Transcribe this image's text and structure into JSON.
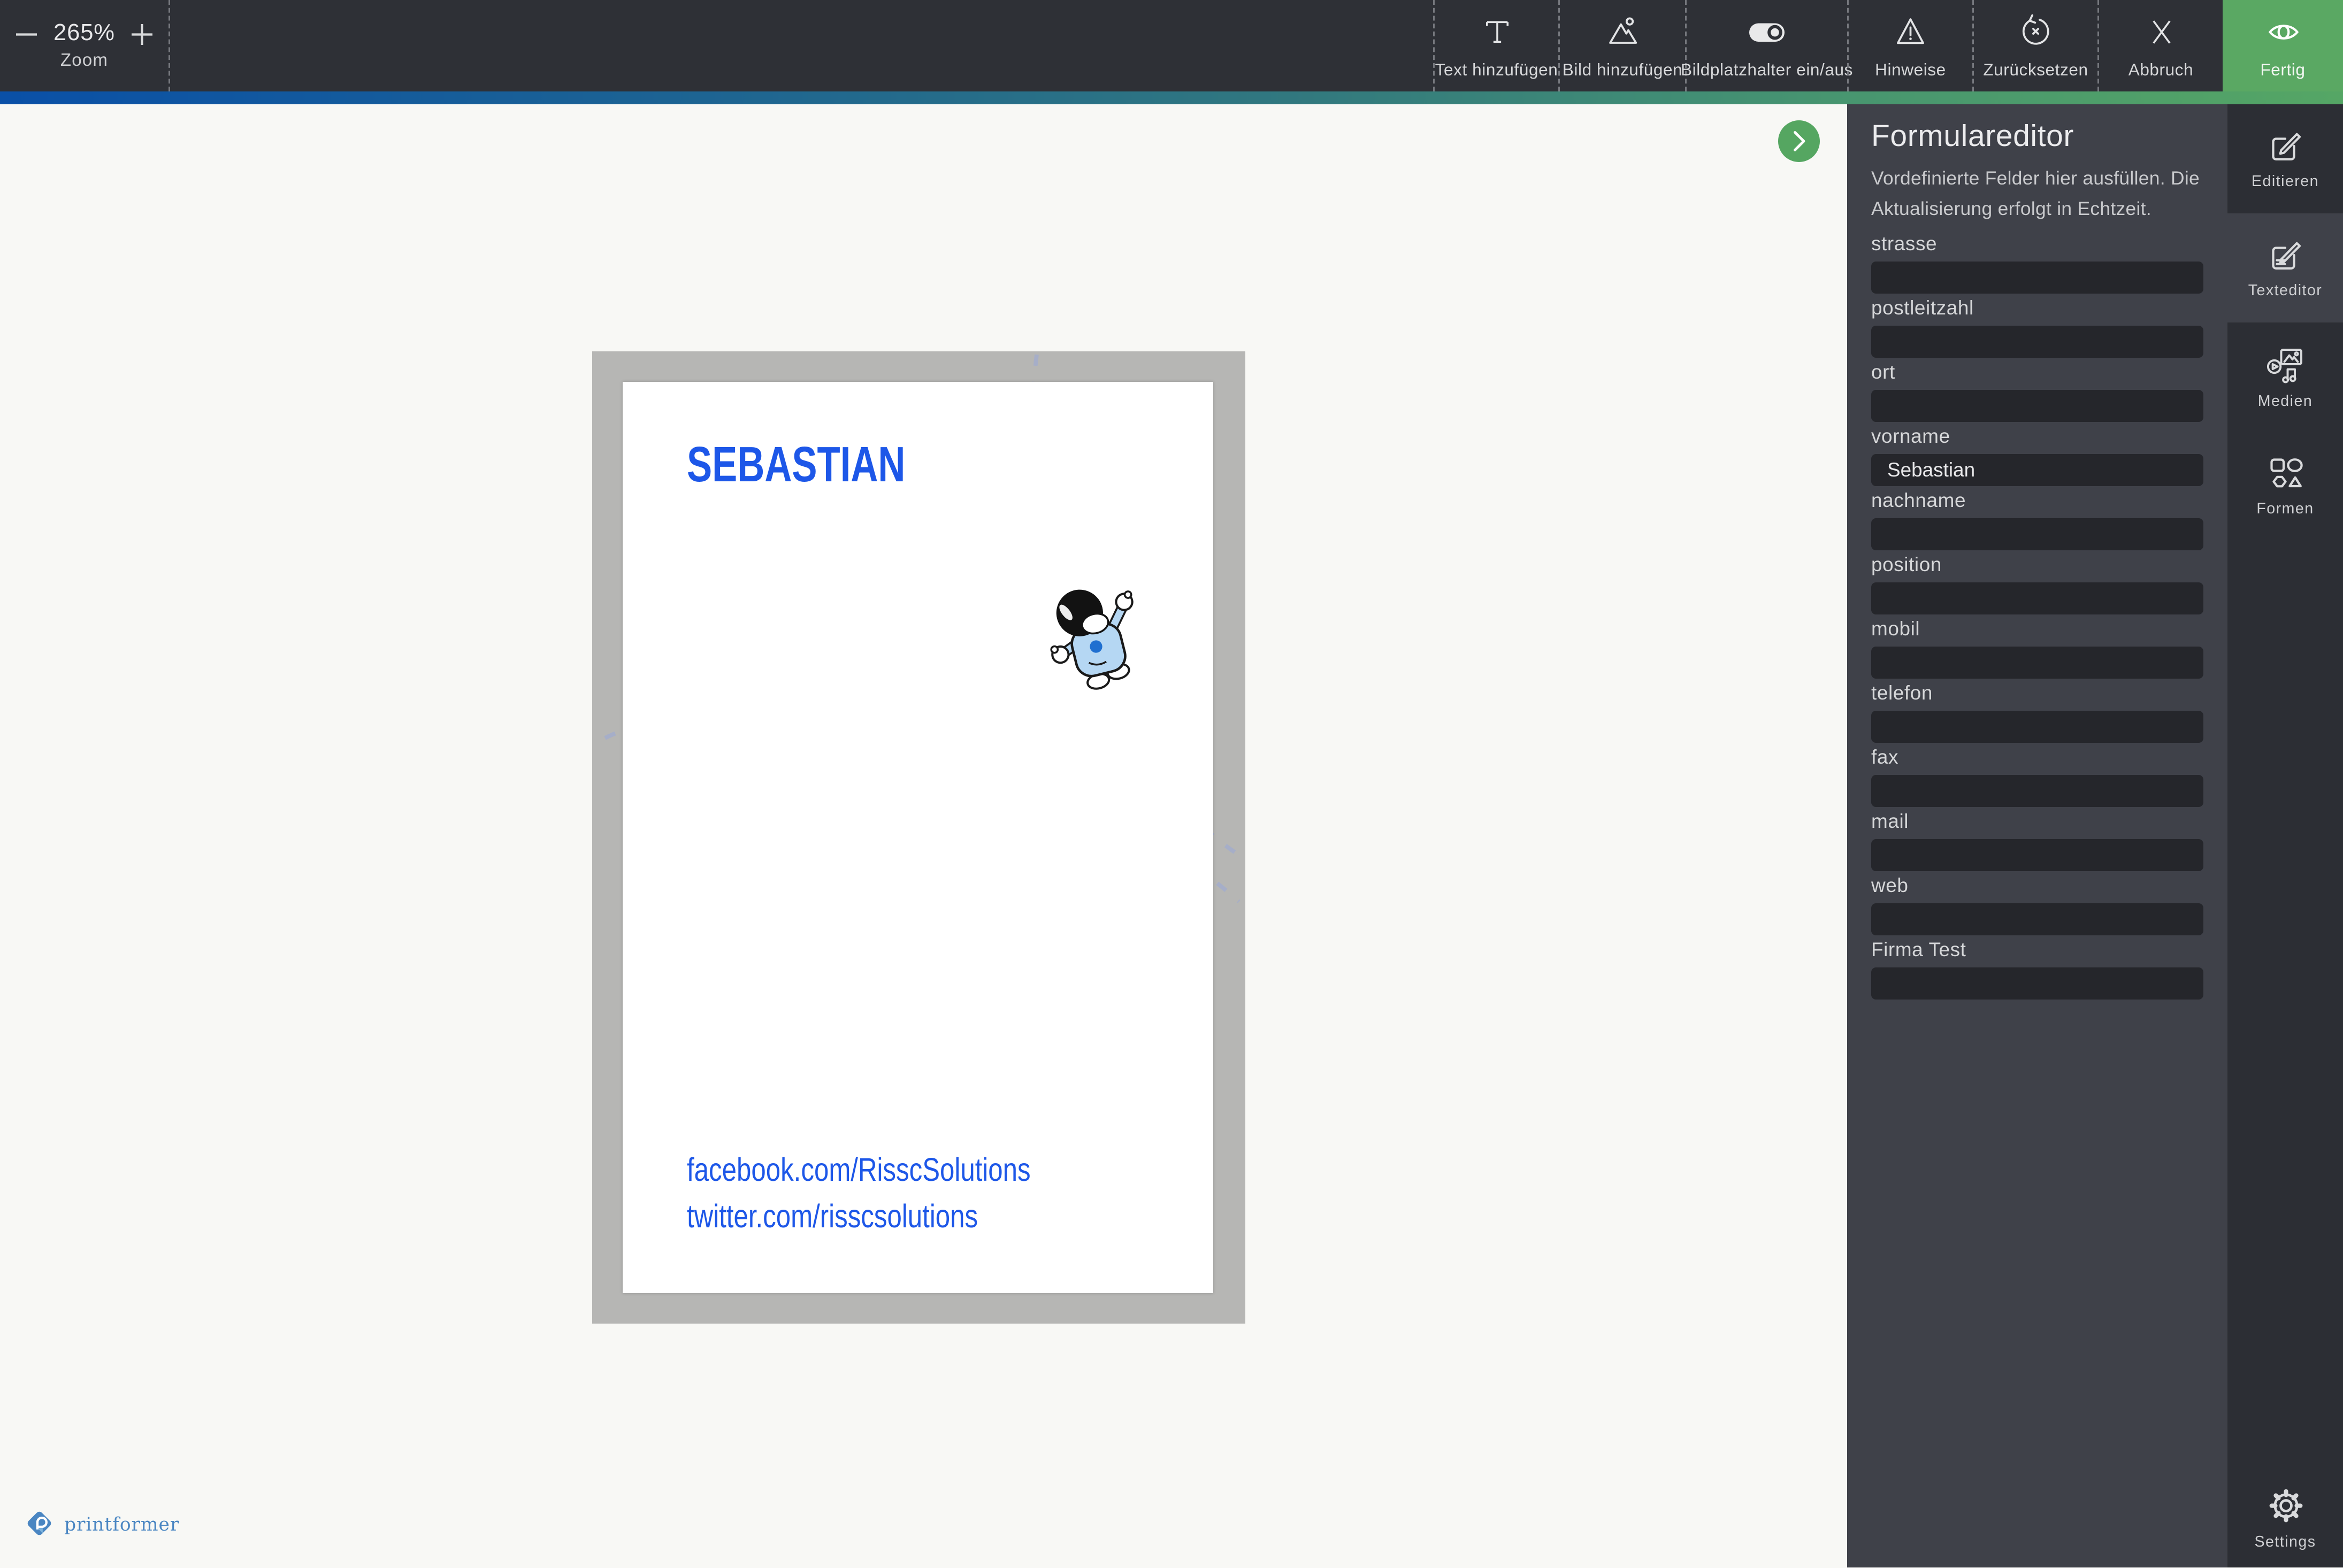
{
  "toolbar": {
    "zoom": {
      "value": "265%",
      "label": "Zoom"
    },
    "buttons": [
      {
        "label": "Text hinzufügen",
        "icon": "text-add-icon"
      },
      {
        "label": "Bild hinzufügen",
        "icon": "image-add-icon"
      },
      {
        "label": "Bildplatzhalter ein/aus",
        "icon": "toggle-on-icon"
      },
      {
        "label": "Hinweise",
        "icon": "warning-icon"
      },
      {
        "label": "Zurücksetzen",
        "icon": "reset-icon"
      },
      {
        "label": "Abbruch",
        "icon": "close-icon"
      },
      {
        "label": "Fertig",
        "icon": "eye-icon"
      }
    ]
  },
  "canvas": {
    "card": {
      "name_text": "SEBASTIAN",
      "social_lines": [
        "facebook.com/RisscSolutions",
        "twitter.com/risscsolutions"
      ],
      "illustration": "astronaut-with-dashed-trajectories"
    },
    "next_button_icon": "chevron-right-icon"
  },
  "form_panel": {
    "title": "Formulareditor",
    "subtitle": "Vordefinierte Felder hier ausfüllen. Die Aktualisierung erfolgt in Echtzeit.",
    "fields": [
      {
        "label": "strasse",
        "value": ""
      },
      {
        "label": "postleitzahl",
        "value": ""
      },
      {
        "label": "ort",
        "value": ""
      },
      {
        "label": "vorname",
        "value": "Sebastian"
      },
      {
        "label": "nachname",
        "value": ""
      },
      {
        "label": "position",
        "value": ""
      },
      {
        "label": "mobil",
        "value": ""
      },
      {
        "label": "telefon",
        "value": ""
      },
      {
        "label": "fax",
        "value": ""
      },
      {
        "label": "mail",
        "value": ""
      },
      {
        "label": "web",
        "value": ""
      },
      {
        "label": "Firma Test",
        "value": ""
      }
    ]
  },
  "sidebar": {
    "items": [
      {
        "label": "Editieren",
        "icon": "edit-icon",
        "active": false
      },
      {
        "label": "Texteditor",
        "icon": "text-editor-icon",
        "active": true
      },
      {
        "label": "Medien",
        "icon": "media-icon",
        "active": false
      },
      {
        "label": "Formen",
        "icon": "shapes-icon",
        "active": false
      }
    ],
    "settings": {
      "label": "Settings",
      "icon": "gear-icon"
    }
  },
  "footer": {
    "brand": "printformer"
  },
  "colors": {
    "accent_green": "#5aa863",
    "gradient_left_blue": "#0a50a7",
    "gradient_right_green": "#55a665",
    "card_text_blue": "#1d57e8",
    "brand_blue": "#4a86c2",
    "panel_bg": "#3f4149",
    "rail_bg": "#2c2e34",
    "toolbar_bg": "#2e3036",
    "input_bg": "#25262b",
    "canvas_bg": "#f8f8f5",
    "card_backdrop_gray": "#b6b6b4"
  }
}
